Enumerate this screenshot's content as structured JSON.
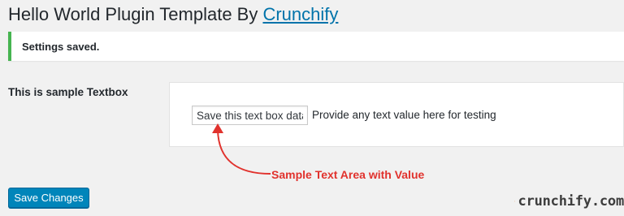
{
  "header": {
    "title": "Hello World Plugin Template By",
    "link_text": "Crunchify"
  },
  "notice": {
    "text": "Settings saved.",
    "color": "#46b450"
  },
  "form": {
    "field_label": "This is sample Textbox",
    "input_value": "Save this text box data",
    "description": "Provide any text value here for testing"
  },
  "annotation": {
    "text": "Sample Text Area with Value",
    "color": "#e1322d"
  },
  "actions": {
    "save_label": "Save Changes",
    "save_color": "#0085ba"
  },
  "brand": {
    "logo_text": "crunchify.com",
    "logo_icon": "crunchify-logo-mark"
  }
}
